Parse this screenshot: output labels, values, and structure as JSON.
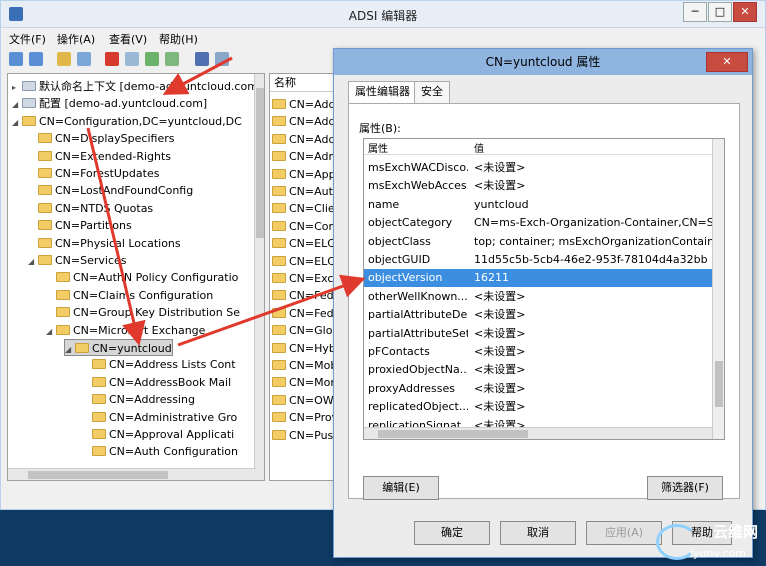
{
  "main_window": {
    "title": "ADSI 编辑器",
    "min_glyph": "─",
    "max_glyph": "□",
    "close_glyph": "✕"
  },
  "menu": [
    "文件(F)",
    "操作(A)",
    "查看(V)",
    "帮助(H)"
  ],
  "tree": {
    "rows": [
      {
        "label": "默认命名上下文 [demo-ad.yuntcloud.com",
        "expander": "▸",
        "depth": 0,
        "icon": "server"
      },
      {
        "label": "配置 [demo-ad.yuntcloud.com]",
        "expander": "◢",
        "depth": 0,
        "icon": "server"
      },
      {
        "label": "CN=Configuration,DC=yuntcloud,DC",
        "expander": "◢",
        "depth": 1,
        "icon": "folder"
      },
      {
        "label": "CN=DisplaySpecifiers",
        "expander": "",
        "depth": 2,
        "icon": "folder"
      },
      {
        "label": "CN=Extended-Rights",
        "expander": "",
        "depth": 2,
        "icon": "folder"
      },
      {
        "label": "CN=ForestUpdates",
        "expander": "",
        "depth": 2,
        "icon": "folder"
      },
      {
        "label": "CN=LostAndFoundConfig",
        "expander": "",
        "depth": 2,
        "icon": "folder"
      },
      {
        "label": "CN=NTDS Quotas",
        "expander": "",
        "depth": 2,
        "icon": "folder"
      },
      {
        "label": "CN=Partitions",
        "expander": "",
        "depth": 2,
        "icon": "folder"
      },
      {
        "label": "CN=Physical Locations",
        "expander": "",
        "depth": 2,
        "icon": "folder"
      },
      {
        "label": "CN=Services",
        "expander": "◢",
        "depth": 2,
        "icon": "folder"
      },
      {
        "label": "CN=AuthN Policy Configuratio",
        "expander": "",
        "depth": 3,
        "icon": "folder"
      },
      {
        "label": "CN=Claims Configuration",
        "expander": "",
        "depth": 3,
        "icon": "folder"
      },
      {
        "label": "CN=Group Key Distribution Se",
        "expander": "",
        "depth": 3,
        "icon": "folder"
      },
      {
        "label": "CN=Microsoft Exchange",
        "expander": "◢",
        "depth": 3,
        "icon": "folder"
      },
      {
        "label": "CN=yuntcloud",
        "expander": "◢",
        "depth": 4,
        "icon": "folder",
        "selected": true
      },
      {
        "label": "CN=Address Lists Cont",
        "expander": "",
        "depth": 5,
        "icon": "folder"
      },
      {
        "label": "CN=AddressBook Mail",
        "expander": "",
        "depth": 5,
        "icon": "folder"
      },
      {
        "label": "CN=Addressing",
        "expander": "",
        "depth": 5,
        "icon": "folder"
      },
      {
        "label": "CN=Administrative Gro",
        "expander": "",
        "depth": 5,
        "icon": "folder"
      },
      {
        "label": "CN=Approval Applicati",
        "expander": "",
        "depth": 5,
        "icon": "folder"
      },
      {
        "label": "CN=Auth Configuration",
        "expander": "",
        "depth": 5,
        "icon": "folder"
      }
    ]
  },
  "list": {
    "header": "名称",
    "rows": [
      "CN=Add",
      "CN=Add",
      "CN=Add",
      "CN=Adm",
      "CN=App",
      "CN=Auth",
      "CN=Clier",
      "CN=Conr",
      "CN=ELC",
      "CN=ELC",
      "CN=Exch",
      "CN=Fede",
      "CN=Fede",
      "CN=Glob",
      "CN=Hybi",
      "CN=Mob",
      "CN=Mon",
      "CN=OWA",
      "CN=Prov",
      "CN=Push"
    ]
  },
  "dialog": {
    "title": "CN=yuntcloud 属性",
    "close_glyph": "✕",
    "tabs": [
      "属性编辑器",
      "安全"
    ],
    "attributes_label": "属性(B):",
    "col_attr": "属性",
    "col_value": "值",
    "rows": [
      {
        "attr": "msExchWACDisco...",
        "value": "<未设置>"
      },
      {
        "attr": "msExchWebAcces...",
        "value": "<未设置>"
      },
      {
        "attr": "name",
        "value": "yuntcloud"
      },
      {
        "attr": "objectCategory",
        "value": "CN=ms-Exch-Organization-Container,CN=Sche"
      },
      {
        "attr": "objectClass",
        "value": "top; container; msExchOrganizationContainer"
      },
      {
        "attr": "objectGUID",
        "value": "11d55c5b-5cb4-46e2-953f-78104d4a32bb"
      },
      {
        "attr": "objectVersion",
        "value": "16211",
        "selected": true
      },
      {
        "attr": "otherWellKnown...",
        "value": "<未设置>"
      },
      {
        "attr": "partialAttributeDe...",
        "value": "<未设置>"
      },
      {
        "attr": "partialAttributeSet",
        "value": "<未设置>"
      },
      {
        "attr": "pFContacts",
        "value": "<未设置>"
      },
      {
        "attr": "proxiedObjectNa...",
        "value": "<未设置>"
      },
      {
        "attr": "proxyAddresses",
        "value": "<未设置>"
      },
      {
        "attr": "replicatedObject...",
        "value": "<未设置>"
      },
      {
        "attr": "replicationSignat...",
        "value": "<未设置>"
      }
    ],
    "edit_button": "编辑(E)",
    "filter_button": "筛选器(F)",
    "ok_button": "确定",
    "cancel_button": "取消",
    "apply_button": "应用(A)",
    "help_button": "帮助"
  },
  "watermark": {
    "text": "云维网",
    "url": "iyunv.com"
  },
  "colors": {
    "selection": "#3c8fe0",
    "annotation_arrow": "#e03a2e",
    "desktop": "#0f3a64"
  }
}
